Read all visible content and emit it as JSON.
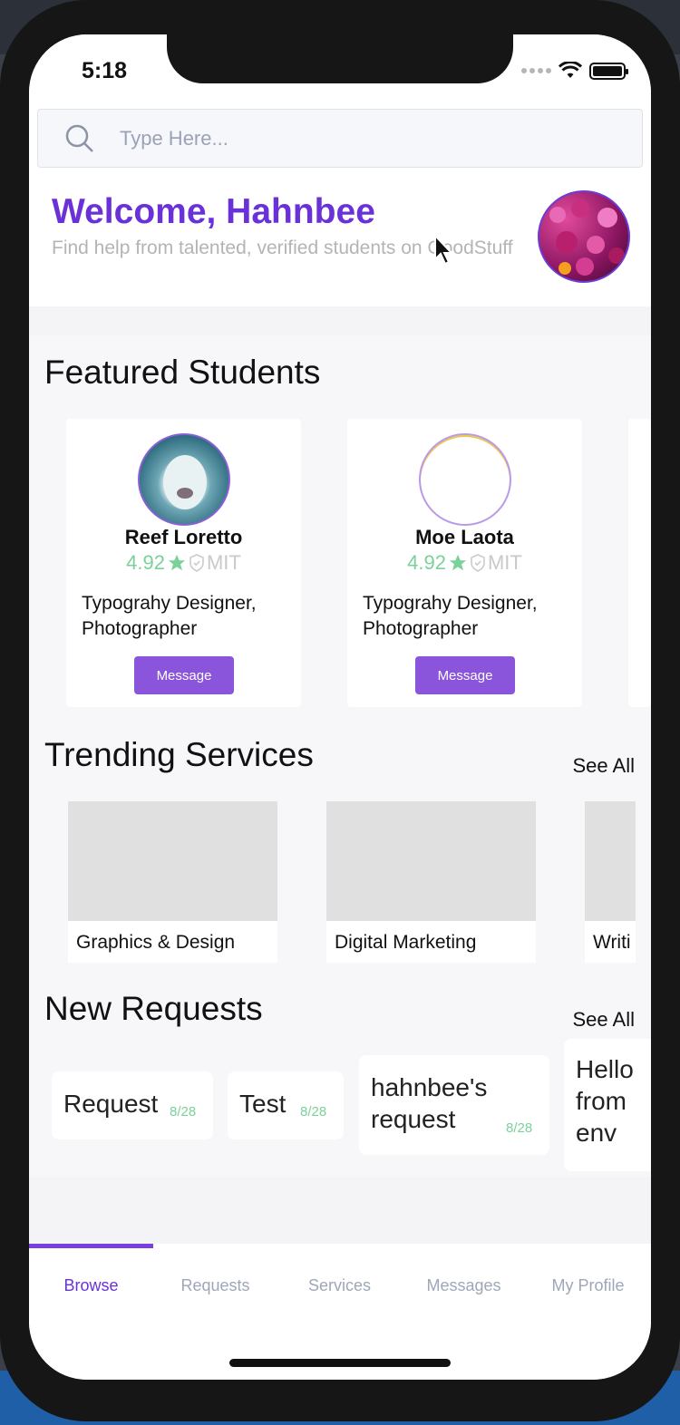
{
  "status_bar": {
    "time": "5:18"
  },
  "search": {
    "placeholder": "Type Here..."
  },
  "header": {
    "welcome": "Welcome, Hahnbee",
    "subtitle": "Find help from talented, verified students on GoodStuff"
  },
  "featured": {
    "title": "Featured Students",
    "students": [
      {
        "name": "Reef Loretto",
        "rating": "4.92",
        "school": "MIT",
        "roles": "Typograhy Designer, Photographer",
        "button": "Message"
      },
      {
        "name": "Moe Laota",
        "rating": "4.92",
        "school": "MIT",
        "roles": "Typograhy Designer, Photographer",
        "button": "Message"
      }
    ]
  },
  "trending": {
    "title": "Trending Services",
    "see_all": "See All",
    "services": [
      "Graphics & Design",
      "Digital Marketing",
      "Writi"
    ]
  },
  "requests": {
    "title": "New Requests",
    "see_all": "See All",
    "items": [
      {
        "title": "Request",
        "date": "8/28"
      },
      {
        "title": "Test",
        "date": "8/28"
      },
      {
        "title": "hahnbee's request",
        "date": "8/28"
      },
      {
        "title": "Hello from env",
        "date": ""
      }
    ]
  },
  "tabs": [
    "Browse",
    "Requests",
    "Services",
    "Messages",
    "My Profile"
  ],
  "colors": {
    "accent": "#6a31d8",
    "rating": "#7bd19a",
    "button": "#8a55db"
  }
}
